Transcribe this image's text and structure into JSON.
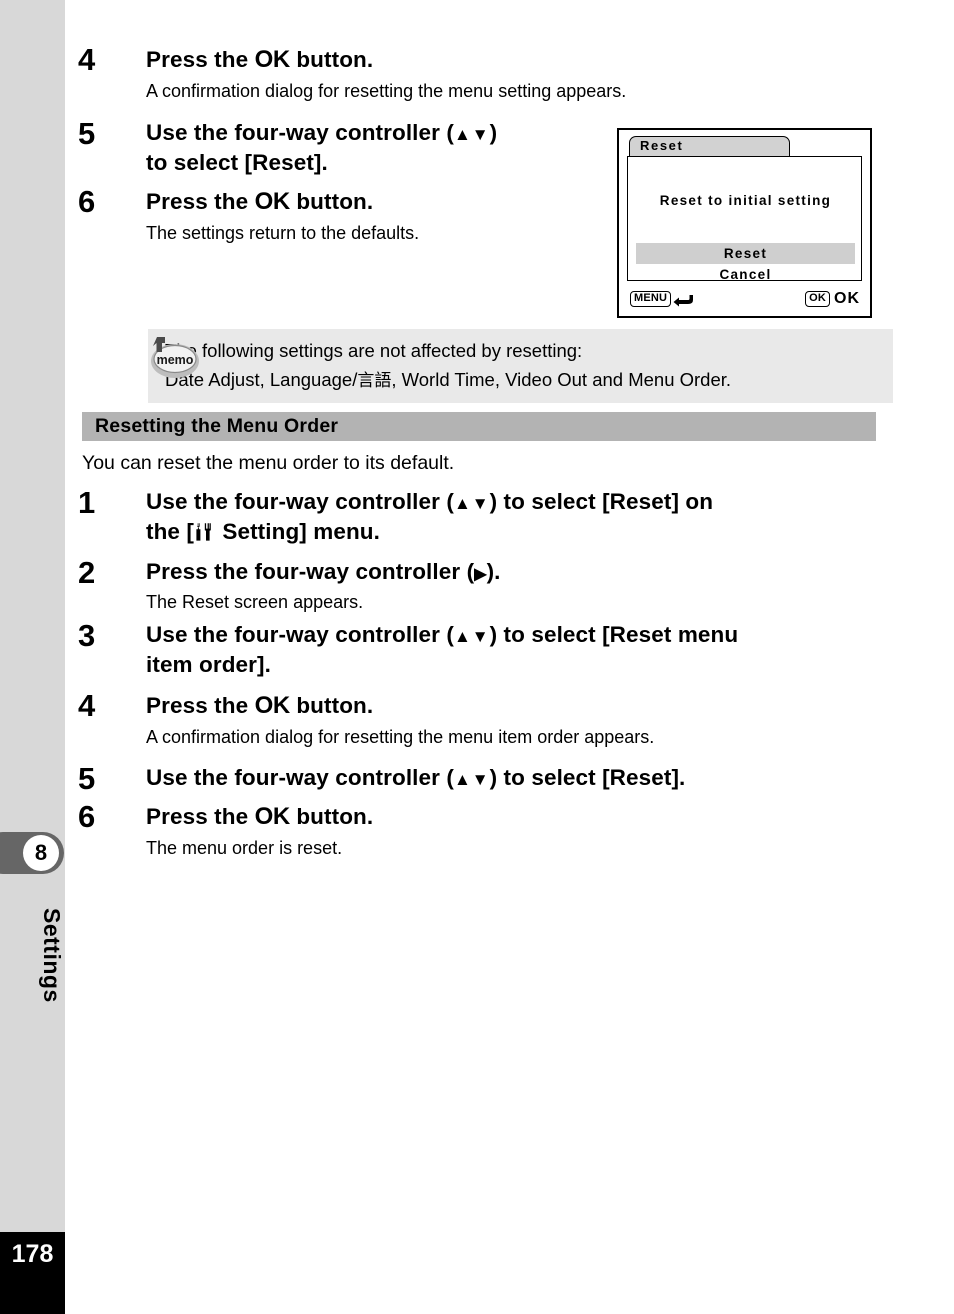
{
  "page": {
    "number": "178",
    "chapter_number": "8",
    "chapter_label": "Settings"
  },
  "section_one": {
    "steps": [
      {
        "num": "4",
        "title_before": "Press the ",
        "title_ok": "OK",
        "title_after": " button.",
        "desc": "A confirmation dialog for resetting the menu setting appears."
      },
      {
        "num": "5",
        "title_line1_before": "Use the four-way controller (",
        "title_line1_arrows": "▲▼",
        "title_line1_after": ")",
        "title_line2": "to select [Reset].",
        "desc": ""
      },
      {
        "num": "6",
        "title_before": "Press the ",
        "title_ok": "OK",
        "title_after": " button.",
        "desc": "The settings return to the defaults."
      }
    ]
  },
  "memo": {
    "icon_label": "memo",
    "line1": "The following settings are not affected by resetting:",
    "line2_a": "Date Adjust, Language/",
    "line2_jp": "言語",
    "line2_b": ", World Time, Video Out and Menu Order."
  },
  "section_two": {
    "header": "Resetting the Menu Order",
    "intro": "You can reset the menu order to its default.",
    "steps": [
      {
        "num": "1",
        "line1_a": "Use the four-way controller (",
        "line1_arrows": "▲▼",
        "line1_b": ") to select [Reset] on",
        "line2_a": "the [",
        "line2_icon": "setting-menu-icon",
        "line2_b": " Setting] menu.",
        "desc": ""
      },
      {
        "num": "2",
        "line1_a": "Press the four-way controller (",
        "line1_arrows": "▶",
        "line1_b": ").",
        "desc": "The Reset screen appears."
      },
      {
        "num": "3",
        "line1_a": "Use the four-way controller (",
        "line1_arrows": "▲▼",
        "line1_b": ") to select [Reset menu",
        "line2": "item order].",
        "desc": ""
      },
      {
        "num": "4",
        "title_before": "Press the ",
        "title_ok": "OK",
        "title_after": " button.",
        "desc": "A confirmation dialog for resetting the menu item order appears."
      },
      {
        "num": "5",
        "line1_a": "Use the four-way controller (",
        "line1_arrows": "▲▼",
        "line1_b": ") to select [Reset].",
        "desc": ""
      },
      {
        "num": "6",
        "title_before": "Press the ",
        "title_ok": "OK",
        "title_after": " button.",
        "desc": "The menu order is reset."
      }
    ]
  },
  "lcd": {
    "tab_label": "Reset",
    "dialog_message": "Reset to initial setting",
    "option_selected": "Reset",
    "option_cancel": "Cancel",
    "footer_menu_badge": "MENU",
    "footer_ok_badge": "OK",
    "footer_ok_label": "OK"
  },
  "colors": {
    "rail": "#d8d8d8",
    "chapter_tab": "#666666",
    "memo_bg": "#e9e9e9",
    "section_header_bg": "#b3b3b3",
    "lcd_highlight": "#cfcfcf",
    "page_block": "#000000"
  }
}
